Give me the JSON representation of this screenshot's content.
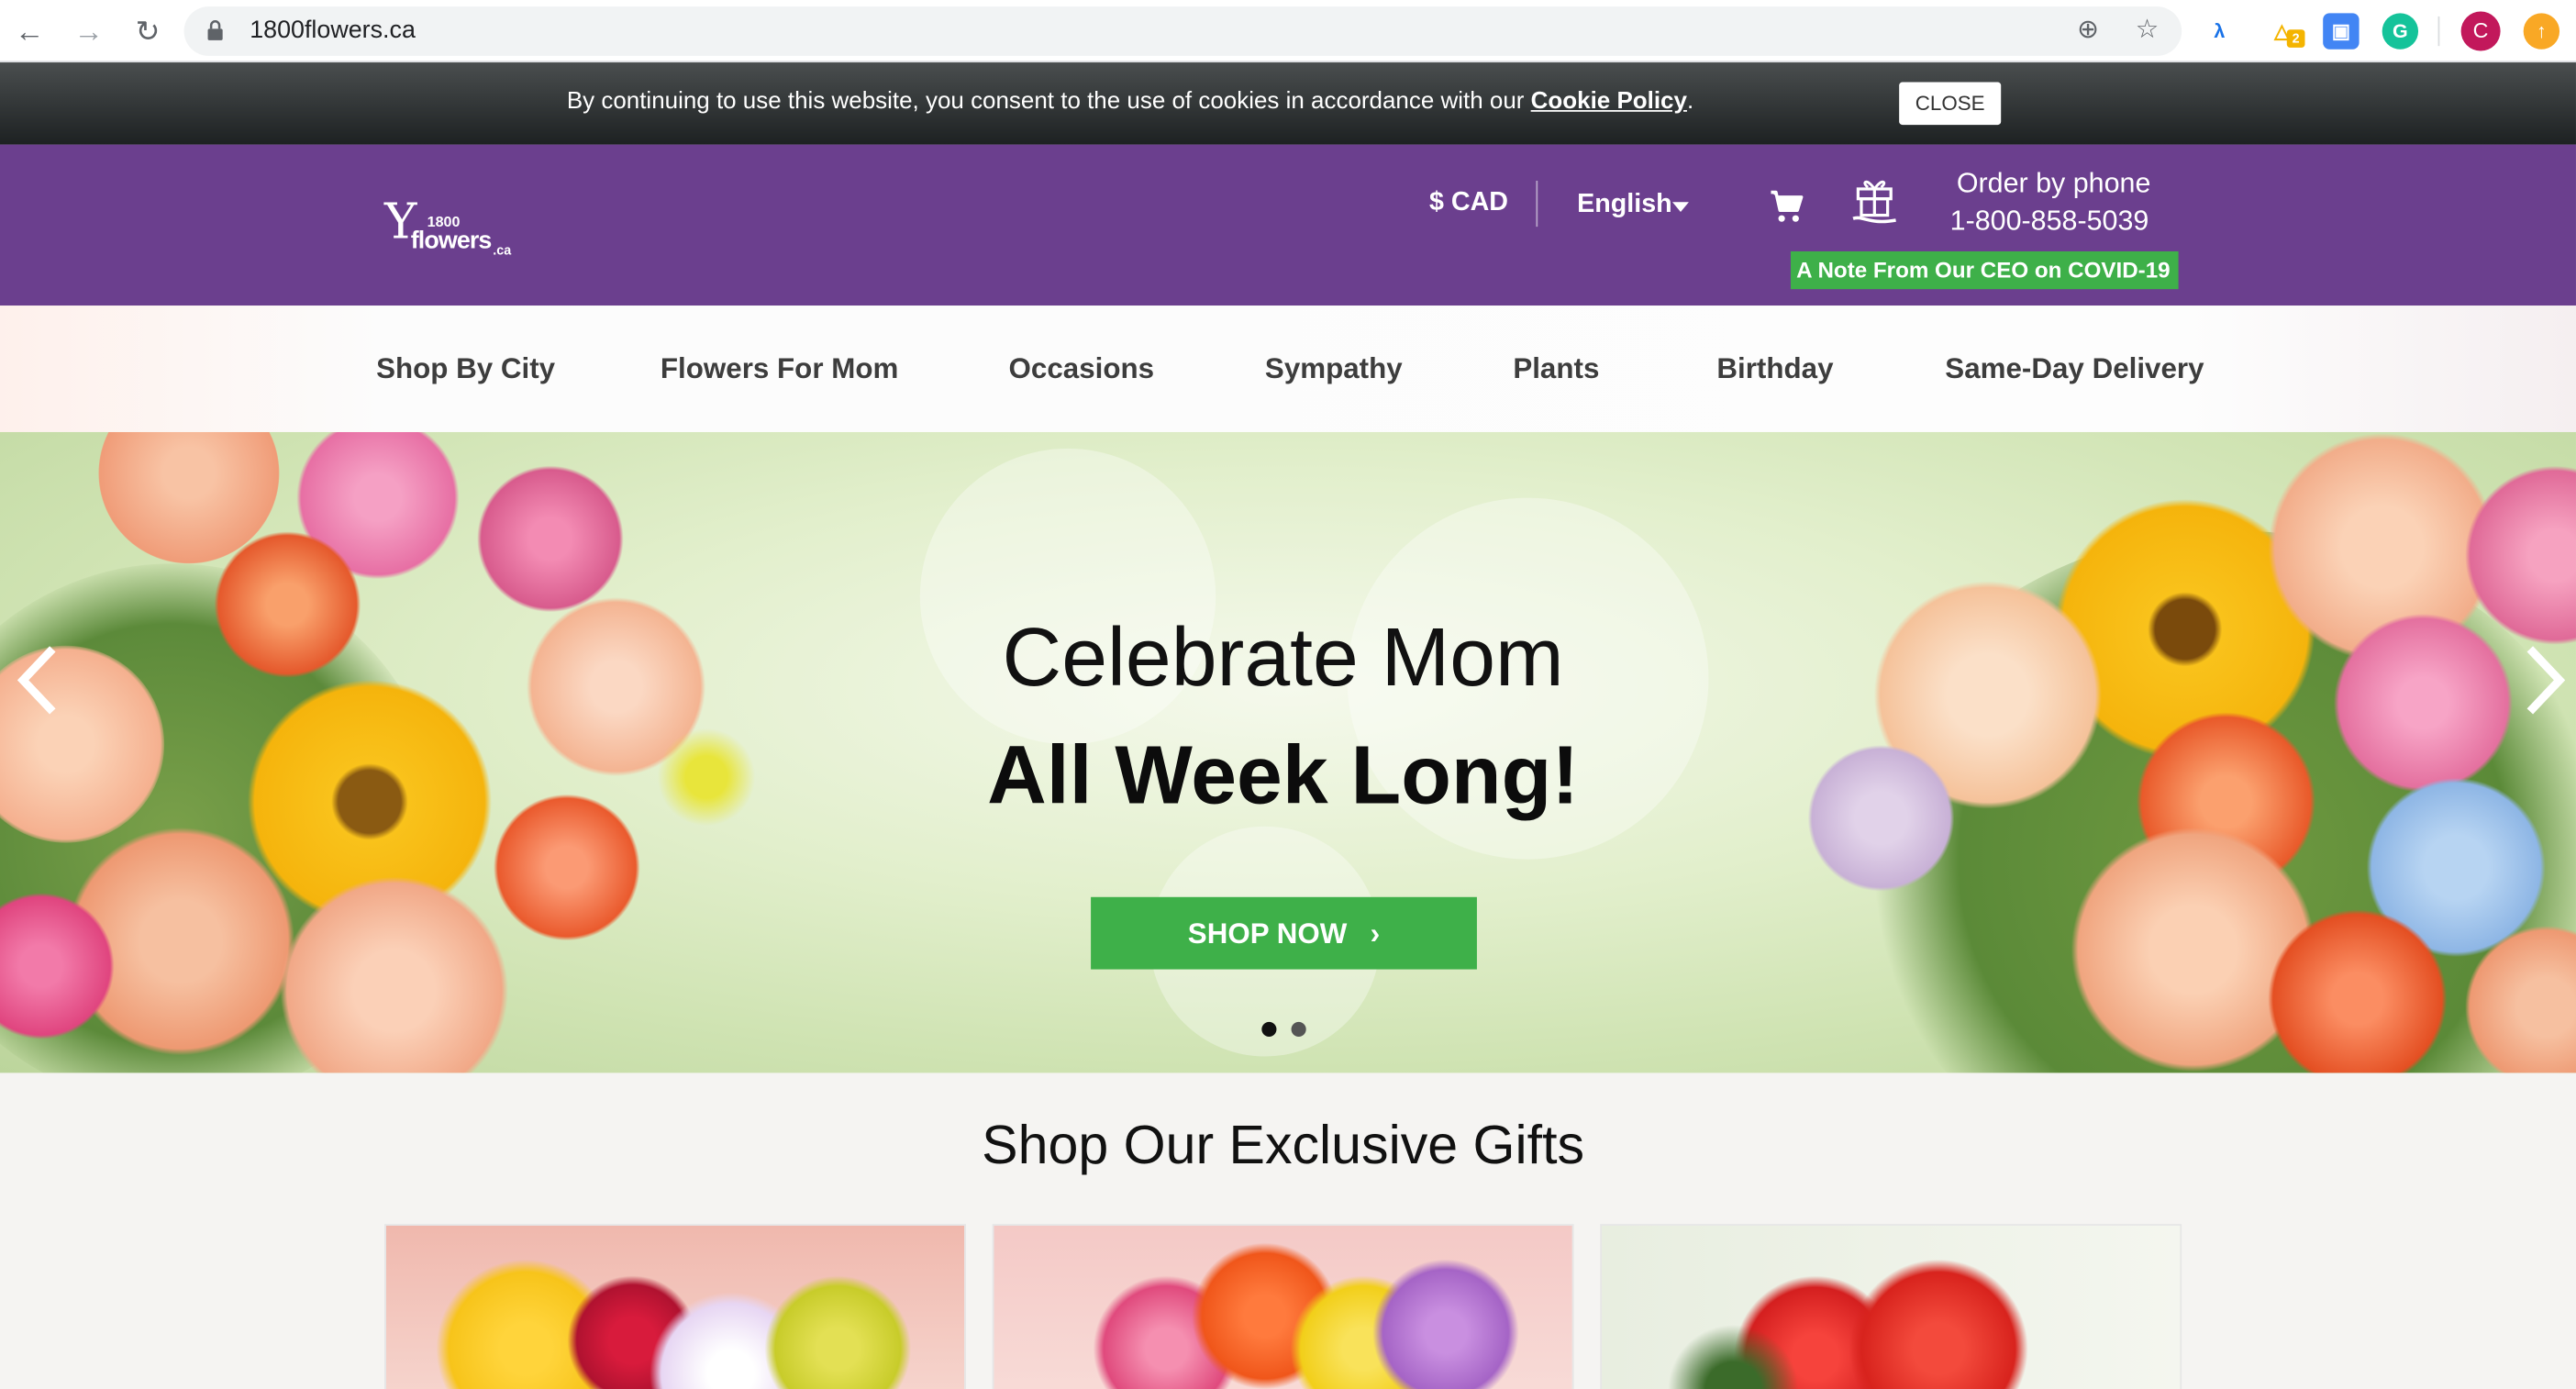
{
  "browser": {
    "url": "1800flowers.ca",
    "profile_initial": "C",
    "extension_badge": "2"
  },
  "cookie": {
    "text": "By continuing to use this website, you consent to the use of cookies in accordance with our ",
    "link": "Cookie Policy",
    "suffix": ".",
    "close_label": "CLOSE"
  },
  "header": {
    "logo": {
      "number": "1800",
      "word": "flowers",
      "suffix": ".ca"
    },
    "currency": "$ CAD",
    "language": "English",
    "order_label": "Order by phone",
    "order_phone": "1-800-858-5039",
    "ceo_note": "A Note From Our CEO on COVID-19"
  },
  "nav": {
    "items": [
      "Shop By City",
      "Flowers For Mom",
      "Occasions",
      "Sympathy",
      "Plants",
      "Birthday",
      "Same-Day Delivery"
    ]
  },
  "hero": {
    "line1": "Celebrate Mom",
    "line2": "All Week Long!",
    "cta": "SHOP NOW",
    "slide_count": 2,
    "active_slide": 1
  },
  "section": {
    "title": "Shop Our Exclusive Gifts"
  },
  "colors": {
    "brand_purple": "#6b3f8e",
    "accent_green": "#3eb049"
  },
  "icons": [
    "back-icon",
    "forward-icon",
    "reload-icon",
    "lock-icon",
    "add-icon",
    "star-icon",
    "cart-icon",
    "gift-icon",
    "chevron-left-icon",
    "chevron-right-icon"
  ]
}
